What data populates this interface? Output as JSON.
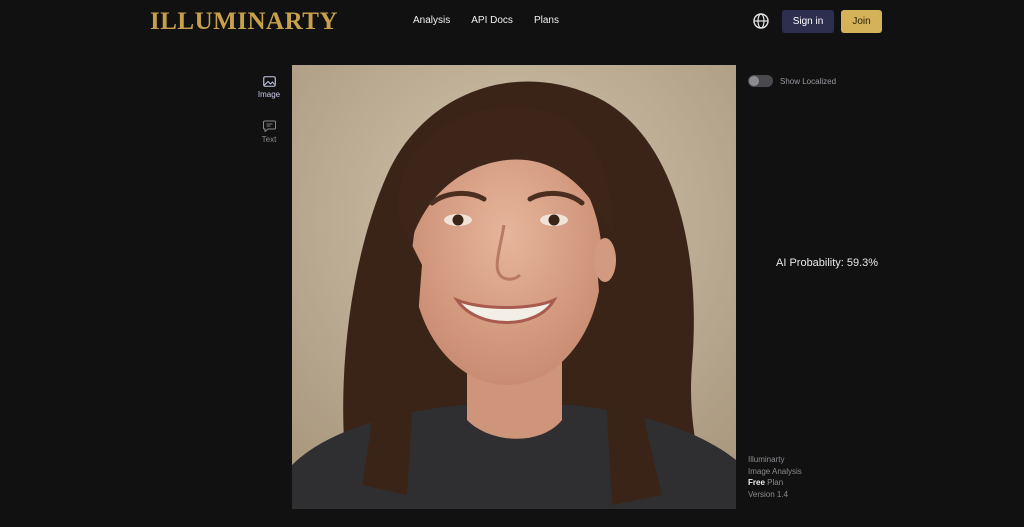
{
  "header": {
    "logo": "ILLUMINARTY",
    "nav": [
      "Analysis",
      "API Docs",
      "Plans"
    ],
    "signin_label": "Sign in",
    "join_label": "Join"
  },
  "tabs": {
    "image_label": "Image",
    "text_label": "Text"
  },
  "panel": {
    "toggle_label": "Show Localized",
    "probability_label": "AI Probability:",
    "probability_value": "59.3%"
  },
  "footer": {
    "line1": "Illuminarty",
    "line2": "Image Analysis",
    "plan_name": "Free",
    "plan_suffix": "Plan",
    "version": "Version 1.4"
  },
  "colors": {
    "background": "#111112",
    "logo_gold": "#c8a04a",
    "signin_bg": "#2e2f4e",
    "join_bg": "#d4b25a"
  },
  "icons": {
    "globe": "globe-icon",
    "image_tab": "image-icon",
    "text_tab": "message-icon"
  }
}
